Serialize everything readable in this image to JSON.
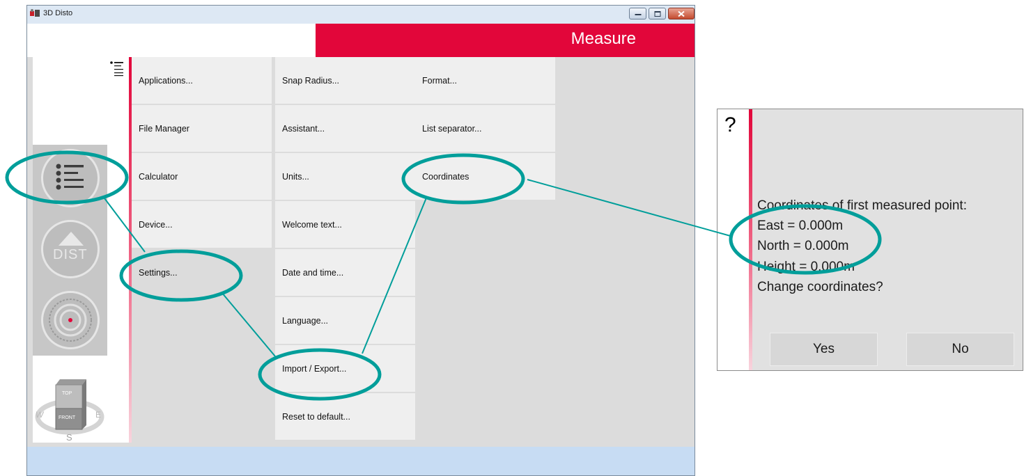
{
  "window": {
    "title": "3D Disto",
    "app_icon": "disto-app-icon",
    "controls": [
      "minimize-icon",
      "maximize-icon",
      "close-icon"
    ]
  },
  "header": {
    "title": "Measure",
    "home_icon": "home-icon"
  },
  "rail": {
    "menu_icon": "menu-list-icon",
    "dist_label": "DIST",
    "target_icon": "crosshair-target-icon",
    "compass": {
      "top": "TOP",
      "front": "FRONT",
      "west": "W",
      "east": "E",
      "south": "S"
    }
  },
  "strip": {
    "icon": "menu-list-icon"
  },
  "menu": {
    "col1": [
      "Applications...",
      "File Manager",
      "Calculator",
      "Device...",
      "Settings..."
    ],
    "col2": [
      "Snap Radius...",
      "Assistant...",
      "Units...",
      "Welcome text...",
      "Date and time...",
      "Language...",
      "Import / Export...",
      "Reset to default..."
    ],
    "col3": [
      "Format...",
      "List separator...",
      "Coordinates"
    ]
  },
  "dialog": {
    "icon": "?",
    "lines": [
      "Coordinates of first measured point:",
      "East = 0.000m",
      "North = 0.000m",
      "Height = 0.000m",
      "Change coordinates?"
    ],
    "yes": "Yes",
    "no": "No"
  },
  "colors": {
    "accent_red": "#e2063a",
    "highlight": "#009e9a",
    "status_bar": "#c7dcf3"
  }
}
